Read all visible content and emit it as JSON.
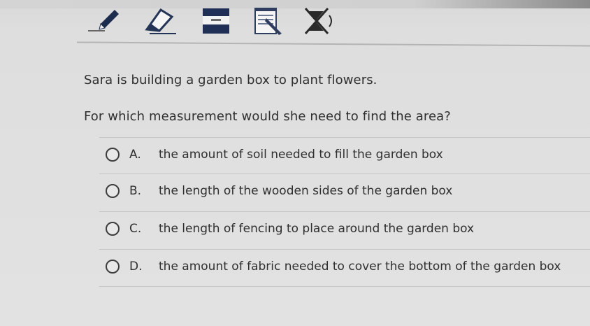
{
  "toolbar": {
    "tools": [
      {
        "icon": "pencil-icon"
      },
      {
        "icon": "eraser-icon"
      },
      {
        "icon": "highlighter-icon"
      },
      {
        "icon": "notepad-icon"
      },
      {
        "icon": "answer-eliminator-icon"
      }
    ]
  },
  "question": {
    "stem_line_1": "Sara is building a garden box to plant flowers.",
    "stem_line_2": "For which measurement would she need to find the area?",
    "options": [
      {
        "letter": "A.",
        "text": "the amount of soil needed to fill the garden box"
      },
      {
        "letter": "B.",
        "text": "the length of the wooden sides of the garden box"
      },
      {
        "letter": "C.",
        "text": "the length of fencing to place around the garden box"
      },
      {
        "letter": "D.",
        "text": "the amount of fabric needed to cover the bottom of the garden box"
      }
    ]
  },
  "colors": {
    "background": "#e0e0e0",
    "text": "#2f2f2f",
    "divider": "#c6c6c6",
    "toolbar_accent": "#1f2f55"
  }
}
